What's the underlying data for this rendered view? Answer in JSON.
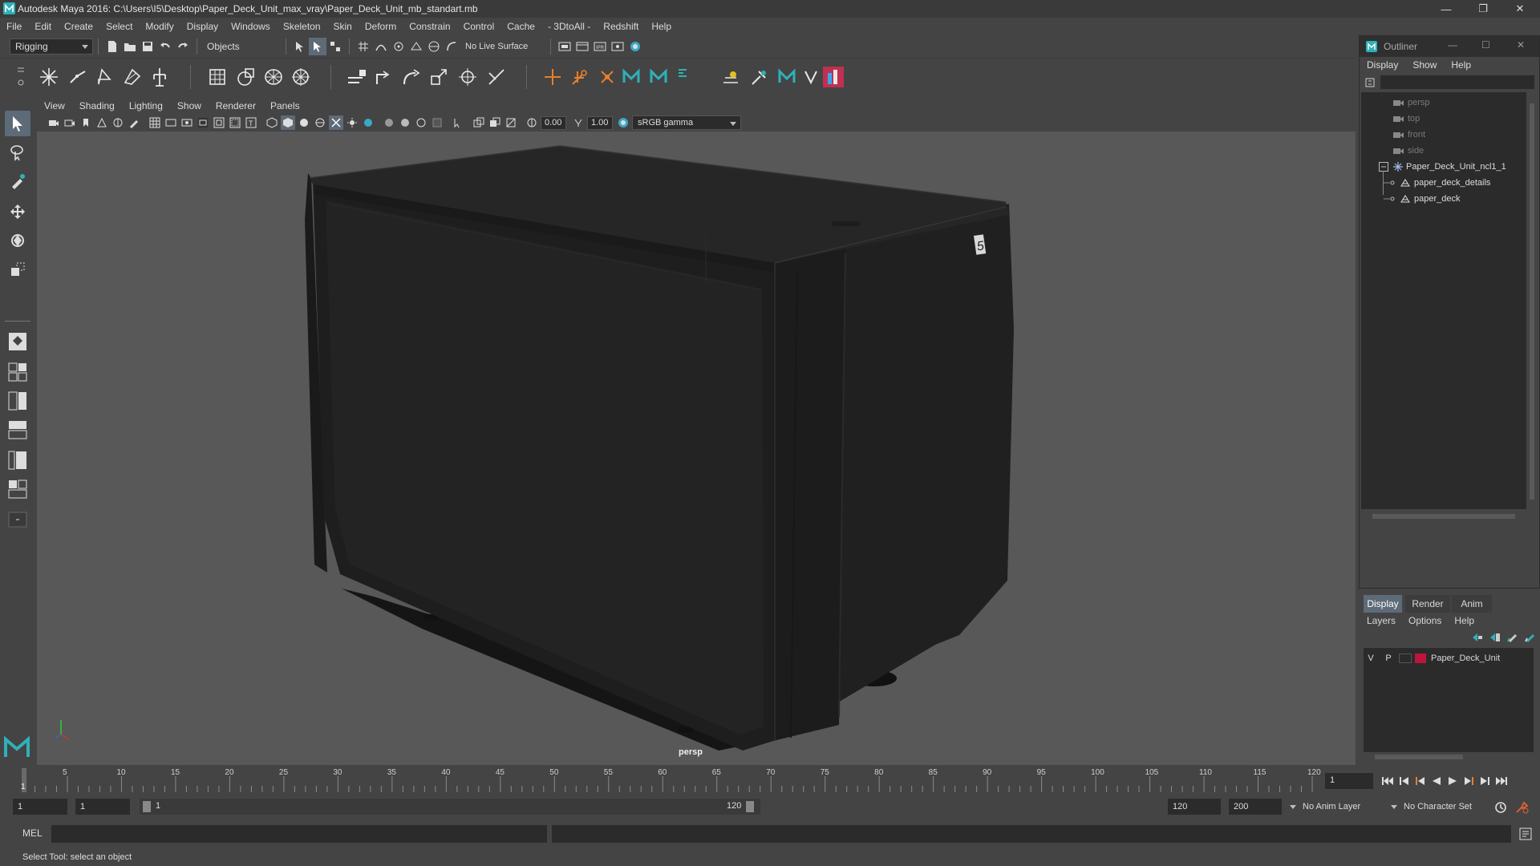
{
  "window": {
    "title": "Autodesk Maya 2016: C:\\Users\\I5\\Desktop\\Paper_Deck_Unit_max_vray\\Paper_Deck_Unit_mb_standart.mb",
    "minimize": "—",
    "restore": "❐",
    "close": "✕"
  },
  "menubar": [
    "File",
    "Edit",
    "Create",
    "Select",
    "Modify",
    "Display",
    "Windows",
    "Skeleton",
    "Skin",
    "Deform",
    "Constrain",
    "Control",
    "Cache",
    "- 3DtoAll -",
    "Redshift",
    "Help"
  ],
  "statusline": {
    "menuset": "Rigging",
    "selection_mode": "Objects",
    "live_surface": "No Live Surface"
  },
  "panel": {
    "menu": [
      "View",
      "Shading",
      "Lighting",
      "Show",
      "Renderer",
      "Panels"
    ],
    "exposure": "0.00",
    "gamma": "1.00",
    "color_space": "sRGB gamma",
    "camera_label": "persp"
  },
  "outliner": {
    "title": "Outliner",
    "menu": [
      "Display",
      "Show",
      "Help"
    ],
    "items": [
      {
        "label": "persp",
        "type": "camera",
        "dim": true
      },
      {
        "label": "top",
        "type": "camera",
        "dim": true
      },
      {
        "label": "front",
        "type": "camera",
        "dim": true
      },
      {
        "label": "side",
        "type": "camera",
        "dim": true
      },
      {
        "label": "Paper_Deck_Unit_ncl1_1",
        "type": "group",
        "dim": false
      },
      {
        "label": "paper_deck_details",
        "type": "mesh",
        "dim": false
      },
      {
        "label": "paper_deck",
        "type": "mesh",
        "dim": false
      }
    ]
  },
  "layers": {
    "tabs": [
      "Display",
      "Render",
      "Anim"
    ],
    "menu": [
      "Layers",
      "Options",
      "Help"
    ],
    "rows": [
      {
        "v": "V",
        "p": "P",
        "name": "Paper_Deck_Unit",
        "color": "#c0143c"
      }
    ]
  },
  "timeline": {
    "ticks": [
      "5",
      "10",
      "15",
      "20",
      "25",
      "30",
      "35",
      "40",
      "45",
      "50",
      "55",
      "60",
      "65",
      "70",
      "75",
      "80",
      "85",
      "90",
      "95",
      "100",
      "105",
      "110",
      "115",
      "120"
    ],
    "current_frame": "1",
    "start_marker": "1",
    "range_start": "1",
    "range_inner_start": "1",
    "range_slider_start": "1",
    "range_slider_end": "120",
    "range_end": "120",
    "anim_end": "200",
    "anim_layer": "No Anim Layer",
    "character_set": "No Character Set"
  },
  "commandline": {
    "label": "MEL"
  },
  "helpline": {
    "text": "Select Tool: select an object"
  },
  "colors": {
    "accent": "#5d6a78",
    "ui_bg": "#444444",
    "viewport_bg": "#585858",
    "layer_color": "#c0143c",
    "maya_teal": "#2fb0b8"
  }
}
